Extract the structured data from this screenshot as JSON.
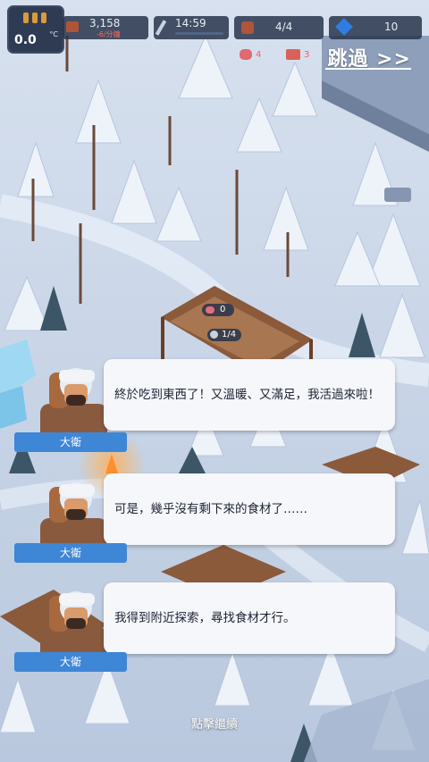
{
  "hud": {
    "temperature": "0.0",
    "temperature_unit": "°C",
    "wood_count": "3,158",
    "wood_rate": "-6/分鐘",
    "time": "14:59",
    "population": "4/4",
    "gems": "10",
    "meat_count": "4",
    "ticket_count": "3"
  },
  "skip_label": "跳過 >>",
  "cabin": {
    "meat_count": "0",
    "workers": "1/4"
  },
  "dialogues": [
    {
      "speaker": "大衛",
      "text": "終於吃到東西了！又溫暖、又滿足，我活過來啦！"
    },
    {
      "speaker": "大衛",
      "text": "可是，幾乎沒有剩下來的食材了……"
    },
    {
      "speaker": "大衛",
      "text": "我得到附近探索，尋找食材才行。"
    }
  ],
  "continue_label": "點擊繼續",
  "colors": {
    "snow": "#c9d6e8",
    "name_tag": "#3e86d6",
    "bubble": "#f6f7fb",
    "hud_bg": "#2f3b53"
  }
}
